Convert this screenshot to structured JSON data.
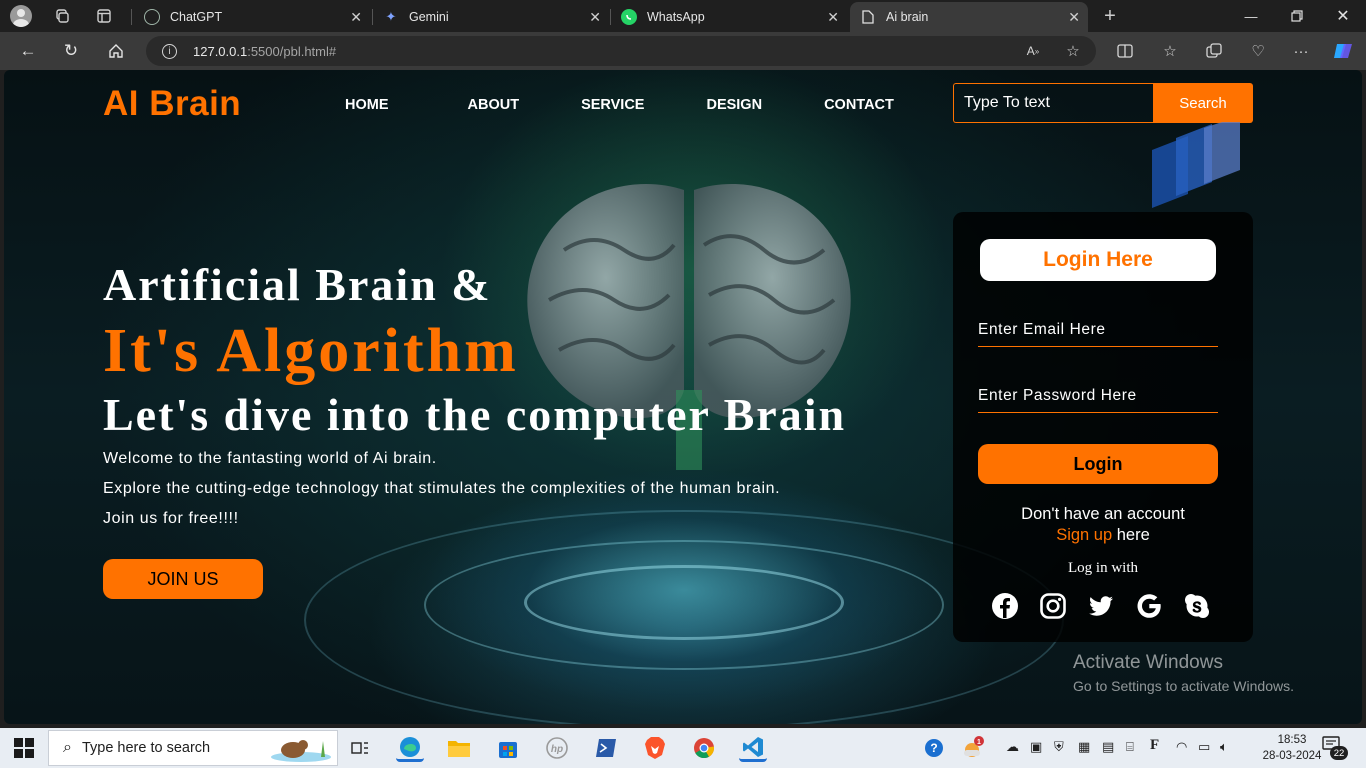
{
  "browser": {
    "tabs": [
      {
        "title": "ChatGPT",
        "icon": "chatgpt-icon"
      },
      {
        "title": "Gemini",
        "icon": "gemini-icon"
      },
      {
        "title": "WhatsApp",
        "icon": "whatsapp-icon"
      },
      {
        "title": "Ai brain",
        "icon": "document-icon",
        "active": true
      }
    ],
    "url_host": "127.0.0.1",
    "url_rest": ":5500/pbl.html#"
  },
  "page": {
    "logo": "AI Brain",
    "nav": [
      "HOME",
      "ABOUT",
      "SERVICE",
      "DESIGN",
      "CONTACT"
    ],
    "search_placeholder": "Type To text",
    "search_button": "Search",
    "hero_line1": "Artificial Brain &",
    "hero_line2": "It's Algorithm",
    "hero_line3": "Let's dive into the computer Brain",
    "para1": "Welcome to the fantasting world of Ai brain.",
    "para2": "Explore the cutting-edge technology that stimulates the complexities of the human brain.",
    "para3": "Join us for free!!!!",
    "join_button": "JOIN US",
    "accent_color": "#ff7200",
    "login": {
      "title": "Login Here",
      "email_placeholder": "Enter Email Here",
      "password_placeholder": "Enter Password Here",
      "button": "Login",
      "no_account": "Don't have an account",
      "signup_link": "Sign up",
      "signup_suffix": " here",
      "login_with": "Log in with",
      "socials": [
        "facebook-icon",
        "instagram-icon",
        "twitter-icon",
        "google-icon",
        "skype-icon"
      ]
    },
    "watermark_title": "Activate Windows",
    "watermark_sub": "Go to Settings to activate Windows."
  },
  "taskbar": {
    "search_placeholder": "Type here to search",
    "time": "18:53",
    "date": "28-03-2024",
    "notifications": "22",
    "badge_count": "1"
  }
}
